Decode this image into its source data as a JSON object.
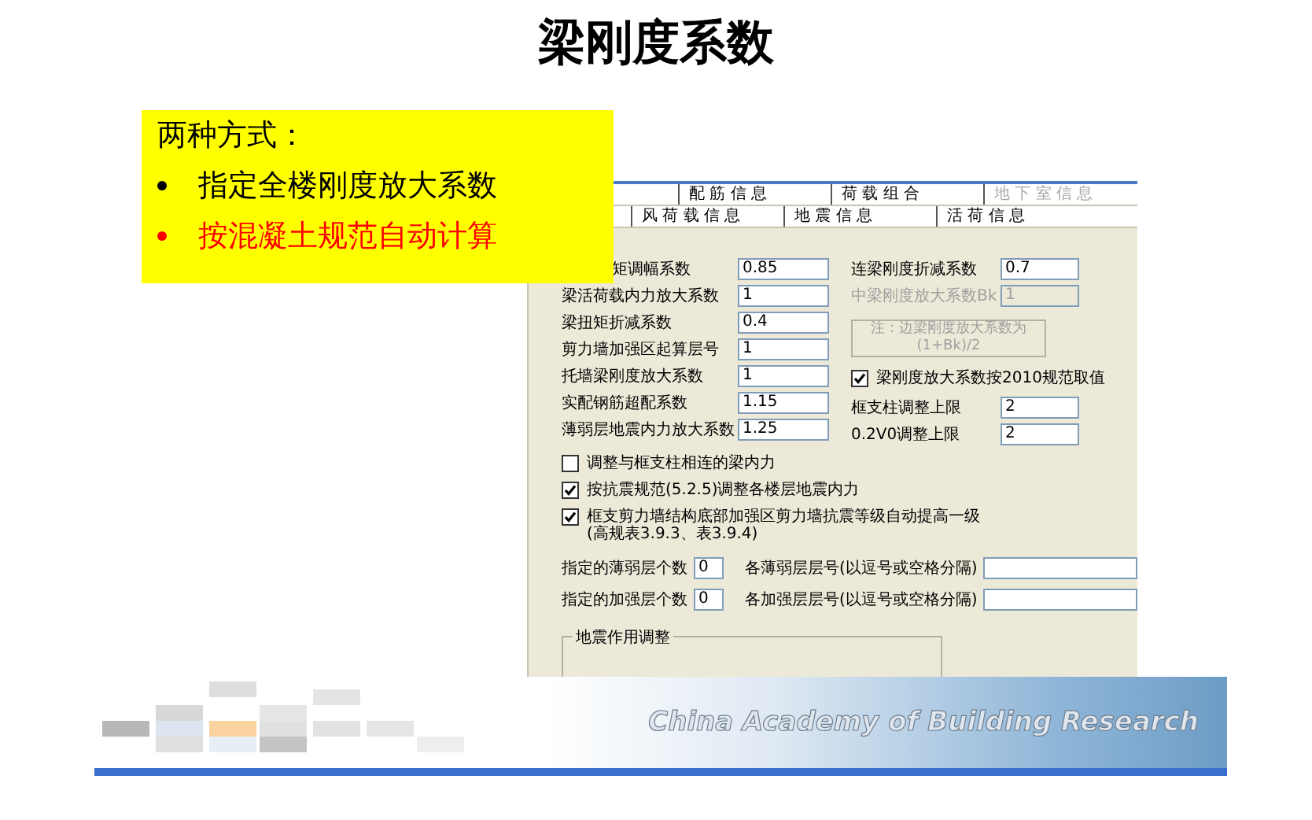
{
  "slide": {
    "title": "梁刚度系数"
  },
  "callout": {
    "heading": "两种方式：",
    "items": [
      {
        "text": "指定全楼刚度放大系数",
        "highlighted": false
      },
      {
        "text": "按混凝土规范自动计算",
        "highlighted": true
      }
    ]
  },
  "dialog": {
    "tabs": [
      [
        {
          "label": "配 筋 信 息",
          "disabled": false
        },
        {
          "label": "荷 载 组 合",
          "disabled": false
        },
        {
          "label": "地 下 室 信 息",
          "disabled": true
        }
      ],
      [
        {
          "label": "风 荷 载 信 息",
          "disabled": false
        },
        {
          "label": "地 震 信 息",
          "disabled": false
        },
        {
          "label": "活 荷 信 息",
          "disabled": false
        }
      ]
    ],
    "left_fields": [
      {
        "label": "矩调幅系数",
        "value": "0.85"
      },
      {
        "label": "梁活荷载内力放大系数",
        "value": "1"
      },
      {
        "label": "梁扭矩折减系数",
        "value": "0.4"
      },
      {
        "label": "剪力墙加强区起算层号",
        "value": "1"
      },
      {
        "label": "托墙梁刚度放大系数",
        "value": "1"
      },
      {
        "label": "实配钢筋超配系数",
        "value": "1.15"
      },
      {
        "label": "薄弱层地震内力放大系数",
        "value": "1.25"
      }
    ],
    "right_items": [
      {
        "kind": "field",
        "label": "连梁刚度折减系数",
        "value": "0.7",
        "disabled": false
      },
      {
        "kind": "field",
        "label": "中梁刚度放大系数Bk",
        "value": "1",
        "disabled": true
      },
      {
        "kind": "note",
        "text": "注：边梁刚度放大系数为\n(1+Bk)/2"
      },
      {
        "kind": "checkbox",
        "label": "梁刚度放大系数按2010规范取值",
        "checked": true
      },
      {
        "kind": "field",
        "label": "框支柱调整上限",
        "value": "2",
        "disabled": false
      },
      {
        "kind": "field",
        "label": "0.2V0调整上限",
        "value": "2",
        "disabled": false
      }
    ],
    "options": [
      {
        "label": "调整与框支柱相连的梁内力",
        "checked": false
      },
      {
        "label": "按抗震规范(5.2.5)调整各楼层地震内力",
        "checked": true
      },
      {
        "label": "框支剪力墙结构底部加强区剪力墙抗震等级自动提高一级\n(高规表3.9.3、表3.9.4)",
        "checked": true
      }
    ],
    "floor_rows": [
      {
        "count_label": "指定的薄弱层个数",
        "count": "0",
        "list_label": "各薄弱层层号(以逗号或空格分隔)"
      },
      {
        "count_label": "指定的加强层个数",
        "count": "0",
        "list_label": "各加强层层号(以逗号或空格分隔)"
      }
    ],
    "group": {
      "title": "地震作用调整"
    }
  },
  "banner": {
    "text": "China Academy of Building Research"
  }
}
